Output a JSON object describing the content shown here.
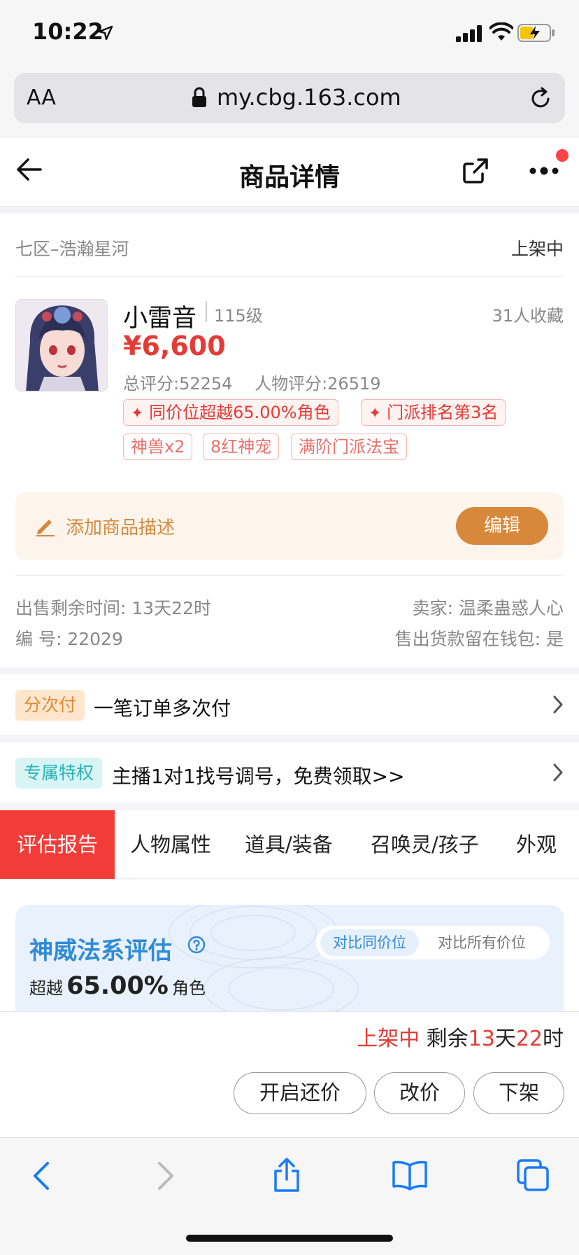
{
  "status_bar": {
    "time": "10:22"
  },
  "browser": {
    "font_size_label": "AA",
    "url": "my.cbg.163.com"
  },
  "header": {
    "title": "商品详情"
  },
  "listing": {
    "server": "七区–浩瀚星河",
    "status": "上架中",
    "character_name": "小雷音",
    "level": "115级",
    "favorites": "31人收藏",
    "price": "¥6,600",
    "total_score": "总评分:52254",
    "character_score": "人物评分:26519",
    "highlight_tags": [
      "同价位超越65.00%角色",
      "门派排名第3名"
    ],
    "tags": [
      "神兽x2",
      "8红神宠",
      "满阶门派法宝"
    ]
  },
  "description": {
    "add_label": "添加商品描述",
    "edit_label": "编辑"
  },
  "details": {
    "remaining_time": "出售剩余时间: 13天22时",
    "seller": "卖家: 温柔蛊惑人心",
    "serial": "编 号: 22029",
    "wallet": "售出货款留在钱包: 是"
  },
  "installment": {
    "badge": "分次付",
    "text": "一笔订单多次付"
  },
  "privilege": {
    "badge": "专属特权",
    "text": "主播1对1找号调号，免费领取>>"
  },
  "tabs": [
    {
      "label": "评估报告",
      "active": true
    },
    {
      "label": "人物属性"
    },
    {
      "label": "道具/装备"
    },
    {
      "label": "召唤灵/孩子"
    },
    {
      "label": "外观"
    }
  ],
  "evaluation": {
    "title": "神威法系评估",
    "toggle_on": "对比同价位",
    "toggle_off": "对比所有价位",
    "beyond_prefix": "超越",
    "beyond_value": "65.00%",
    "beyond_suffix": "角色"
  },
  "sale_bar": {
    "status": "上架中",
    "remain_prefix": "剩余",
    "days": "13",
    "days_unit": "天",
    "hours": "22",
    "hours_unit": "时",
    "buttons": [
      "开启还价",
      "改价",
      "下架"
    ]
  },
  "colors": {
    "accent_red": "#e43b36",
    "orange": "#d8883a",
    "blue": "#2e8bd8",
    "teal": "#29b3b8"
  }
}
